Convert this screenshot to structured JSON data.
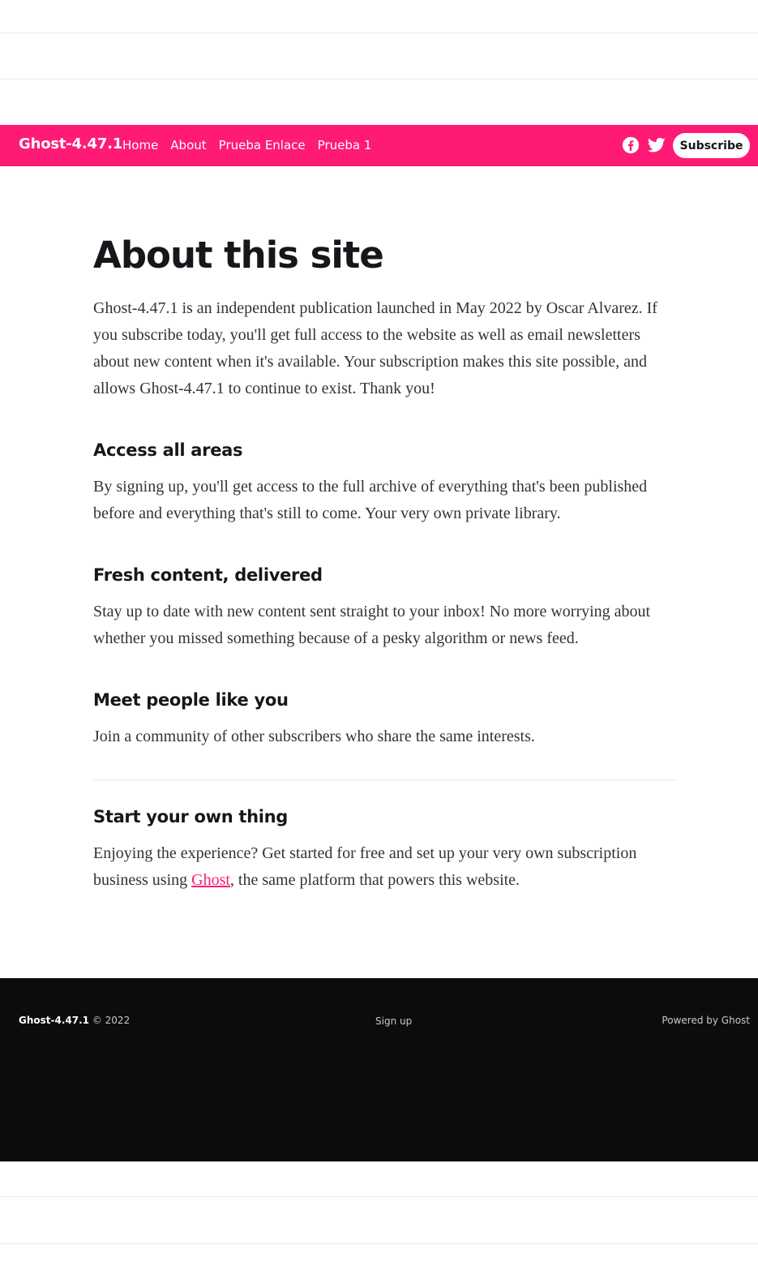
{
  "site": {
    "brand": "Ghost-4.47.1",
    "accent_color": "#ff1a75"
  },
  "nav": {
    "links": [
      {
        "label": "Home"
      },
      {
        "label": "About"
      },
      {
        "label": "Prueba Enlace"
      },
      {
        "label": "Prueba 1"
      }
    ],
    "social_icons": [
      "facebook-icon",
      "twitter-icon"
    ],
    "subscribe_label": "Subscribe"
  },
  "page": {
    "title": "About this site",
    "intro": "Ghost-4.47.1 is an independent publication launched in May 2022 by Oscar Alvarez. If you subscribe today, you'll get full access to the website as well as email newsletters about new content when it's available. Your subscription makes this site possible, and allows Ghost-4.47.1 to continue to exist. Thank you!",
    "sections": [
      {
        "heading": "Access all areas",
        "body": "By signing up, you'll get access to the full archive of everything that's been published before and everything that's still to come. Your very own private library."
      },
      {
        "heading": "Fresh content, delivered",
        "body": "Stay up to date with new content sent straight to your inbox! No more worrying about whether you missed something because of a pesky algorithm or news feed."
      },
      {
        "heading": "Meet people like you",
        "body": "Join a community of other subscribers who share the same interests."
      }
    ],
    "final_section": {
      "heading": "Start your own thing",
      "body_before": "Enjoying the experience? Get started for free and set up your very own subscription business using ",
      "link_label": "Ghost",
      "body_after": ", the same platform that powers this website."
    }
  },
  "footer": {
    "brand": "Ghost-4.47.1",
    "copyright": "© 2022",
    "signup_label": "Sign up",
    "powered_by": "Powered by Ghost"
  }
}
